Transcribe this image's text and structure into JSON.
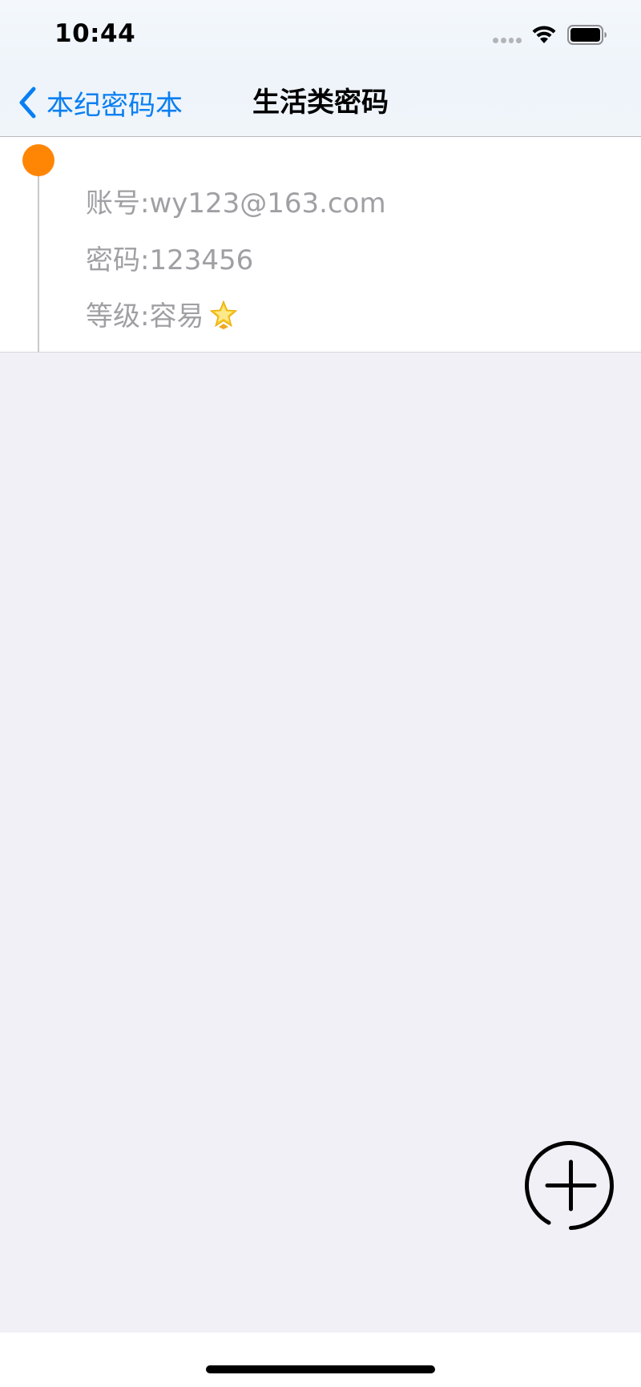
{
  "status_bar": {
    "time": "10:44"
  },
  "nav": {
    "back_label": "本纪密码本",
    "title": "生活类密码"
  },
  "entry": {
    "account": "账号:wy123@163.com",
    "password": "密码:123456",
    "level": "等级:容易",
    "level_icon": "star-icon"
  },
  "colors": {
    "accent": "#0a7ff2",
    "timeline_dot": "#ff8605",
    "secondary_text": "#a0a0a4",
    "background": "#f0f0f6"
  },
  "icons": {
    "back": "chevron-left-icon",
    "add": "add-circle-icon",
    "wifi": "wifi-icon",
    "battery": "battery-icon"
  }
}
